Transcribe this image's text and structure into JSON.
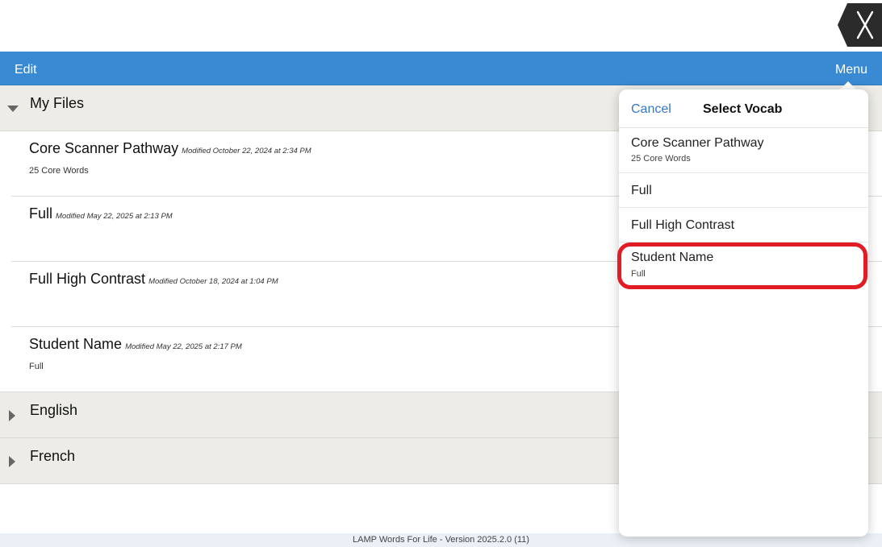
{
  "app": {
    "footer_text": "LAMP Words For Life - Version 2025.2.0 (11)",
    "close_icon": "close-x-icon"
  },
  "navbar": {
    "edit_label": "Edit",
    "menu_label": "Menu",
    "color": "#3a8ad3"
  },
  "sections": {
    "my_files": {
      "title": "My Files",
      "expanded": true,
      "files": [
        {
          "name": "Core Scanner Pathway",
          "modified": "Modified October 22, 2024 at 2:34 PM",
          "sub": "25 Core Words"
        },
        {
          "name": "Full",
          "modified": "Modified May 22, 2025 at 2:13 PM",
          "sub": ""
        },
        {
          "name": "Full High Contrast",
          "modified": "Modified October 18, 2024 at 1:04 PM",
          "sub": ""
        },
        {
          "name": "Student Name",
          "modified": "Modified May 22, 2025 at 2:17 PM",
          "sub": "Full"
        }
      ]
    },
    "english": {
      "title": "English",
      "expanded": false
    },
    "french": {
      "title": "French",
      "expanded": false
    }
  },
  "popover": {
    "cancel_label": "Cancel",
    "title": "Select Vocab",
    "items": [
      {
        "name": "Core Scanner Pathway",
        "sub": "25 Core Words"
      },
      {
        "name": "Full",
        "sub": ""
      },
      {
        "name": "Full High Contrast",
        "sub": ""
      },
      {
        "name": "Student Name",
        "sub": "Full"
      }
    ],
    "highlighted_item": "Student Name",
    "highlight_color": "#e11c24"
  }
}
